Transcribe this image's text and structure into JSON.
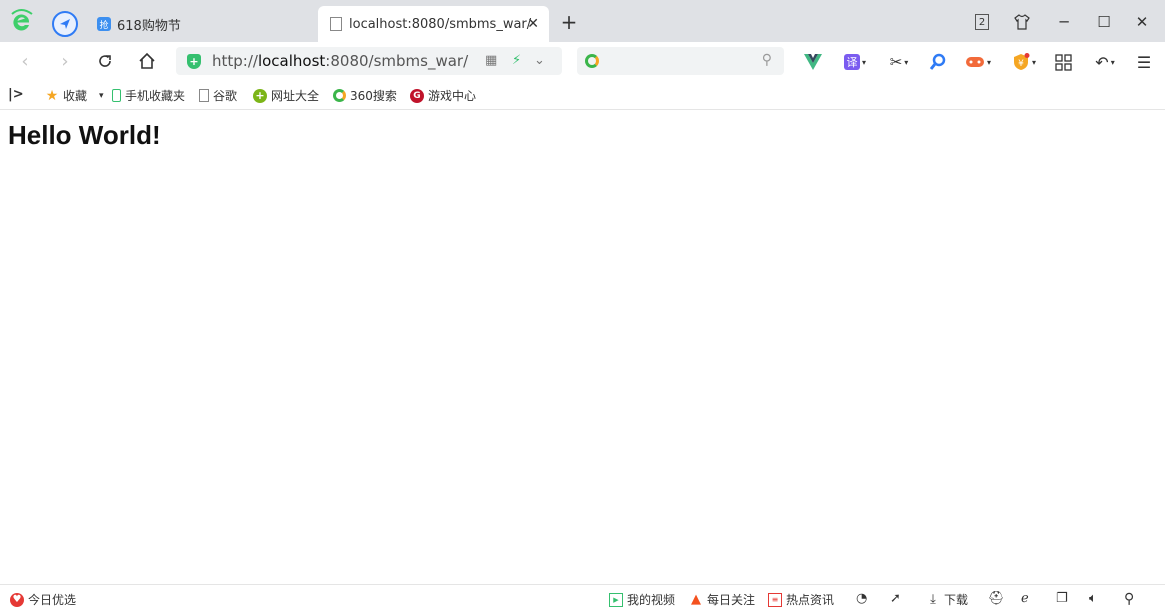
{
  "tabs": [
    {
      "label": "618购物节",
      "favicon": "抢"
    },
    {
      "label": "localhost:8080/smbms_war/"
    }
  ],
  "window": {
    "tab_count": "2"
  },
  "address": {
    "prefix": "http://",
    "host": "localhost",
    "rest": ":8080/smbms_war/"
  },
  "bookmarks": [
    {
      "label": "收藏"
    },
    {
      "label": "手机收藏夹"
    },
    {
      "label": "谷歌"
    },
    {
      "label": "网址大全"
    },
    {
      "label": "360搜索"
    },
    {
      "label": "游戏中心"
    }
  ],
  "page": {
    "heading": "Hello World!"
  },
  "status": {
    "left": "今日优选",
    "items": [
      "我的视频",
      "每日关注",
      "热点资讯",
      "下载"
    ]
  },
  "colors": {
    "accent": "#35c06f",
    "tabbar": "#dfe1e5"
  }
}
